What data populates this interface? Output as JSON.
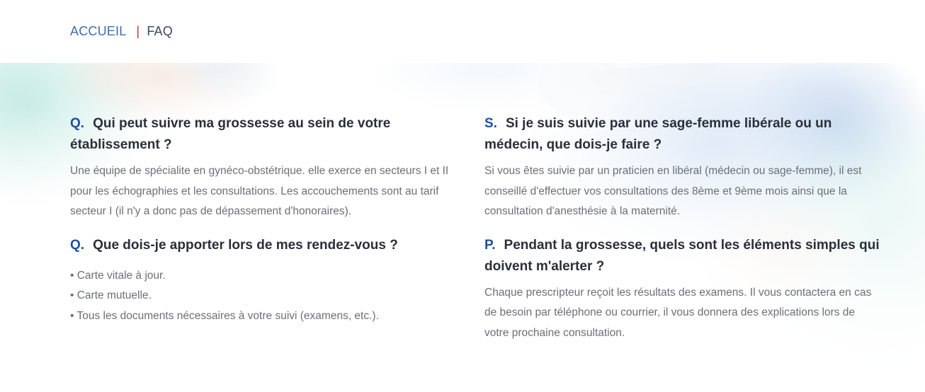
{
  "breadcrumb": {
    "home": "ACCUEIL",
    "separator": "|",
    "current": "FAQ"
  },
  "faq": {
    "left": [
      {
        "marker": "Q.",
        "question": "Qui peut suivre ma grossesse au sein de votre établissement ?",
        "answer": "Une équipe de spécialite en gynéco-obstétrique. elle exerce en secteurs I et II pour les échographies et les consultations. Les accouchements sont au tarif secteur I (il n'y a donc pas de dépassement d'honoraires)."
      },
      {
        "marker": "Q.",
        "question": "Que dois-je apporter lors de mes rendez-vous ?",
        "bullets": [
          "Carte vitale à jour.",
          "Carte mutuelle.",
          "Tous les documents nécessaires à votre suivi (examens, etc.)."
        ]
      }
    ],
    "right": [
      {
        "marker": "S.",
        "question": "Si je suis suivie par une sage-femme libérale ou un médecin, que dois-je faire ?",
        "answer": "Si vous êtes suivie par un praticien en libéral (médecin ou sage-femme), il est conseillé d'effectuer vos consultations des 8ème et 9ème mois ainsi que la consultation d'anesthésie à la maternité."
      },
      {
        "marker": "P.",
        "question": "Pendant la grossesse, quels sont les éléments simples qui doivent m'alerter ?",
        "answer": "Chaque prescripteur reçoit les résultats des examens. Il vous contactera en cas de besoin par téléphone ou courrier, il vous donnera des explications lors de votre prochaine consultation."
      }
    ]
  },
  "colors": {
    "link": "#3a6fb0",
    "separator": "#c0392b",
    "marker": "#1f4ea3",
    "question": "#2a2f3a",
    "answer": "#6b6f78"
  }
}
